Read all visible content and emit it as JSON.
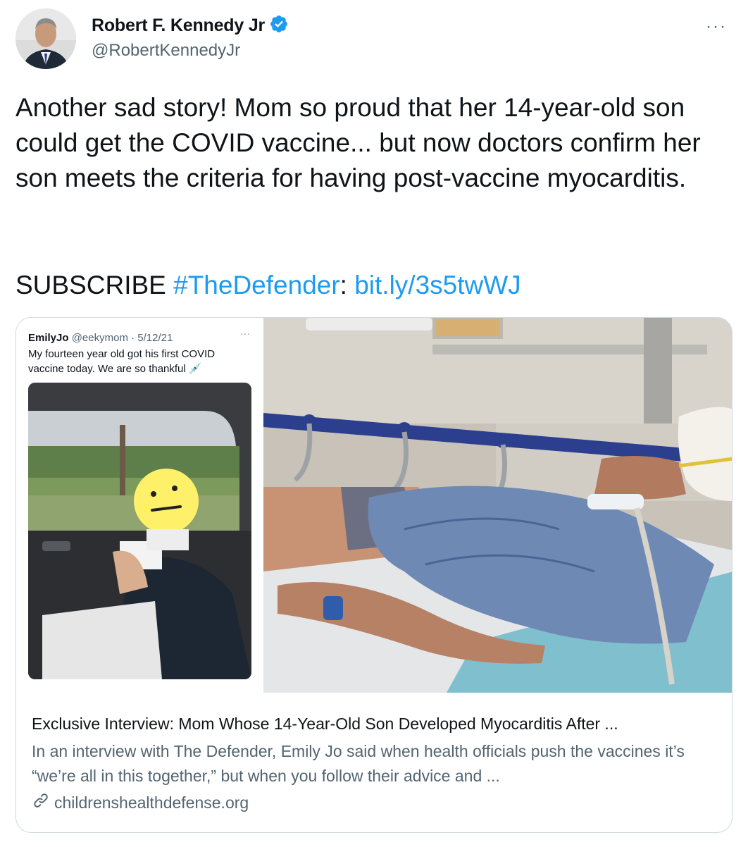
{
  "author": {
    "display_name": "Robert F. Kennedy Jr",
    "handle": "@RobertKennedyJr",
    "more": "···"
  },
  "tweet": {
    "text": "Another sad story! Mom so proud that her 14-year-old son could get the COVID vaccine... but now doctors confirm her son meets the criteria for having post-vaccine myocarditis.",
    "subscribe_prefix": "SUBSCRIBE ",
    "hashtag": "#TheDefender",
    "colon": ": ",
    "short_link": "bit.ly/3s5twWJ"
  },
  "card": {
    "embedded_tweet": {
      "name": "EmilyJo",
      "meta": "@eekymom · 5/12/21",
      "more": "···",
      "text": "My fourteen year old got his first COVID vaccine today. We are so thankful 💉"
    },
    "title": "Exclusive Interview: Mom Whose 14-Year-Old Son Developed Myocarditis After ...",
    "description": "In an interview with The Defender, Emily Jo said when health officials push the vaccines it’s “we’re all in this together,” but when you follow their advice and ...",
    "domain": "childrenshealthdefense.org"
  },
  "colors": {
    "link": "#1d9bf0",
    "secondary_text": "#536471",
    "border": "#cfd9de",
    "verified": "#1d9bf0"
  },
  "icons": [
    "verified-badge-icon",
    "more-icon",
    "link-icon"
  ]
}
